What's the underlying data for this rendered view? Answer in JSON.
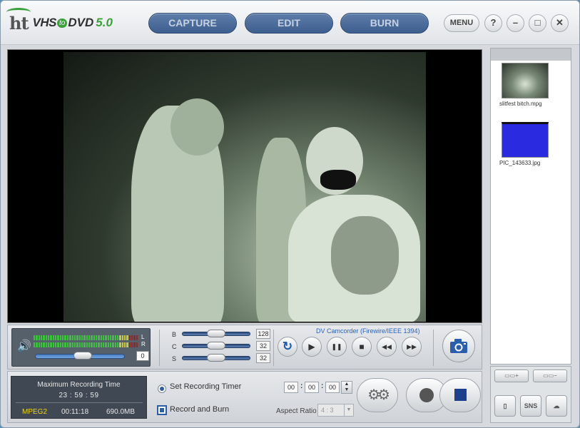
{
  "app": {
    "logo_ht": "ht",
    "logo_vhs": "VHS",
    "logo_to": "to",
    "logo_dvd": "DVD",
    "logo_version": "5.0"
  },
  "nav": {
    "capture": "CAPTURE",
    "edit": "EDIT",
    "burn": "BURN"
  },
  "window_controls": {
    "menu": "MENU",
    "help": "?",
    "minimize": "–",
    "maximize": "□",
    "close": "✕"
  },
  "audio": {
    "left_channel": "L",
    "right_channel": "R",
    "volume_value": "0",
    "volume_level": 0.6
  },
  "video_adjust": {
    "brightness_label": "B",
    "brightness_value": "128",
    "contrast_label": "C",
    "contrast_value": "32",
    "saturation_label": "S",
    "saturation_value": "32"
  },
  "device": {
    "name": "DV Camcorder (Firewire/IEEE 1394)"
  },
  "transport": {
    "refresh": "↻",
    "play": "▶",
    "pause": "❚❚",
    "stop": "■",
    "rewind": "◀◀",
    "forward": "▶▶"
  },
  "recording": {
    "title": "Maximum Recording Time",
    "max_time": "23 : 59 : 59",
    "format": "MPEG2",
    "duration": "00:11:18",
    "size": "690.0MB"
  },
  "options": {
    "set_timer_label": "Set Recording Timer",
    "record_burn_label": "Record and Burn",
    "timer_hours": "00",
    "timer_minutes": "00",
    "timer_seconds": "00",
    "colon": ":",
    "aspect_label": "Aspect Ratio",
    "aspect_value": "4 : 3"
  },
  "files": [
    {
      "name": "slitfest bitch.mpg"
    },
    {
      "name": "PIC_143633.jpg"
    }
  ],
  "colors": {
    "nav_bg": "#4a6a99",
    "accent_green": "#3aa13a",
    "thumb_blue": "#2a2ae0"
  }
}
